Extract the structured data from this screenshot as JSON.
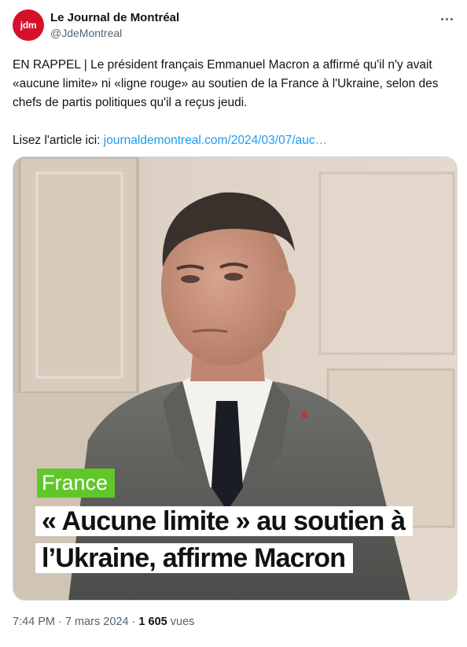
{
  "author": {
    "avatar_text": "jdm",
    "display_name": "Le Journal de Montréal",
    "handle": "@JdeMontreal"
  },
  "tweet": {
    "text": "EN RAPPEL | Le président français Emmanuel Macron a affirmé qu'il n'y avait «aucune limite» ni «ligne rouge» au soutien de la France à l'Ukraine, selon des chefs de partis politiques qu'il a reçus jeudi.",
    "link_prefix": "Lisez l'article ici: ",
    "link_text": "journaldemontreal.com/2024/03/07/auc…"
  },
  "media": {
    "tag": "France",
    "headline": "« Aucune limite » au soutien à l’Ukraine, affirme Macron"
  },
  "meta": {
    "time": "7:44 PM",
    "separator": "·",
    "date": "7 mars 2024",
    "views_count": "1 605",
    "views_label": "vues"
  },
  "colors": {
    "brand_red": "#d3122a",
    "link_blue": "#1d9bf0",
    "tag_green": "#5fc72a"
  },
  "icons": {
    "more": "more-horizontal-icon"
  }
}
